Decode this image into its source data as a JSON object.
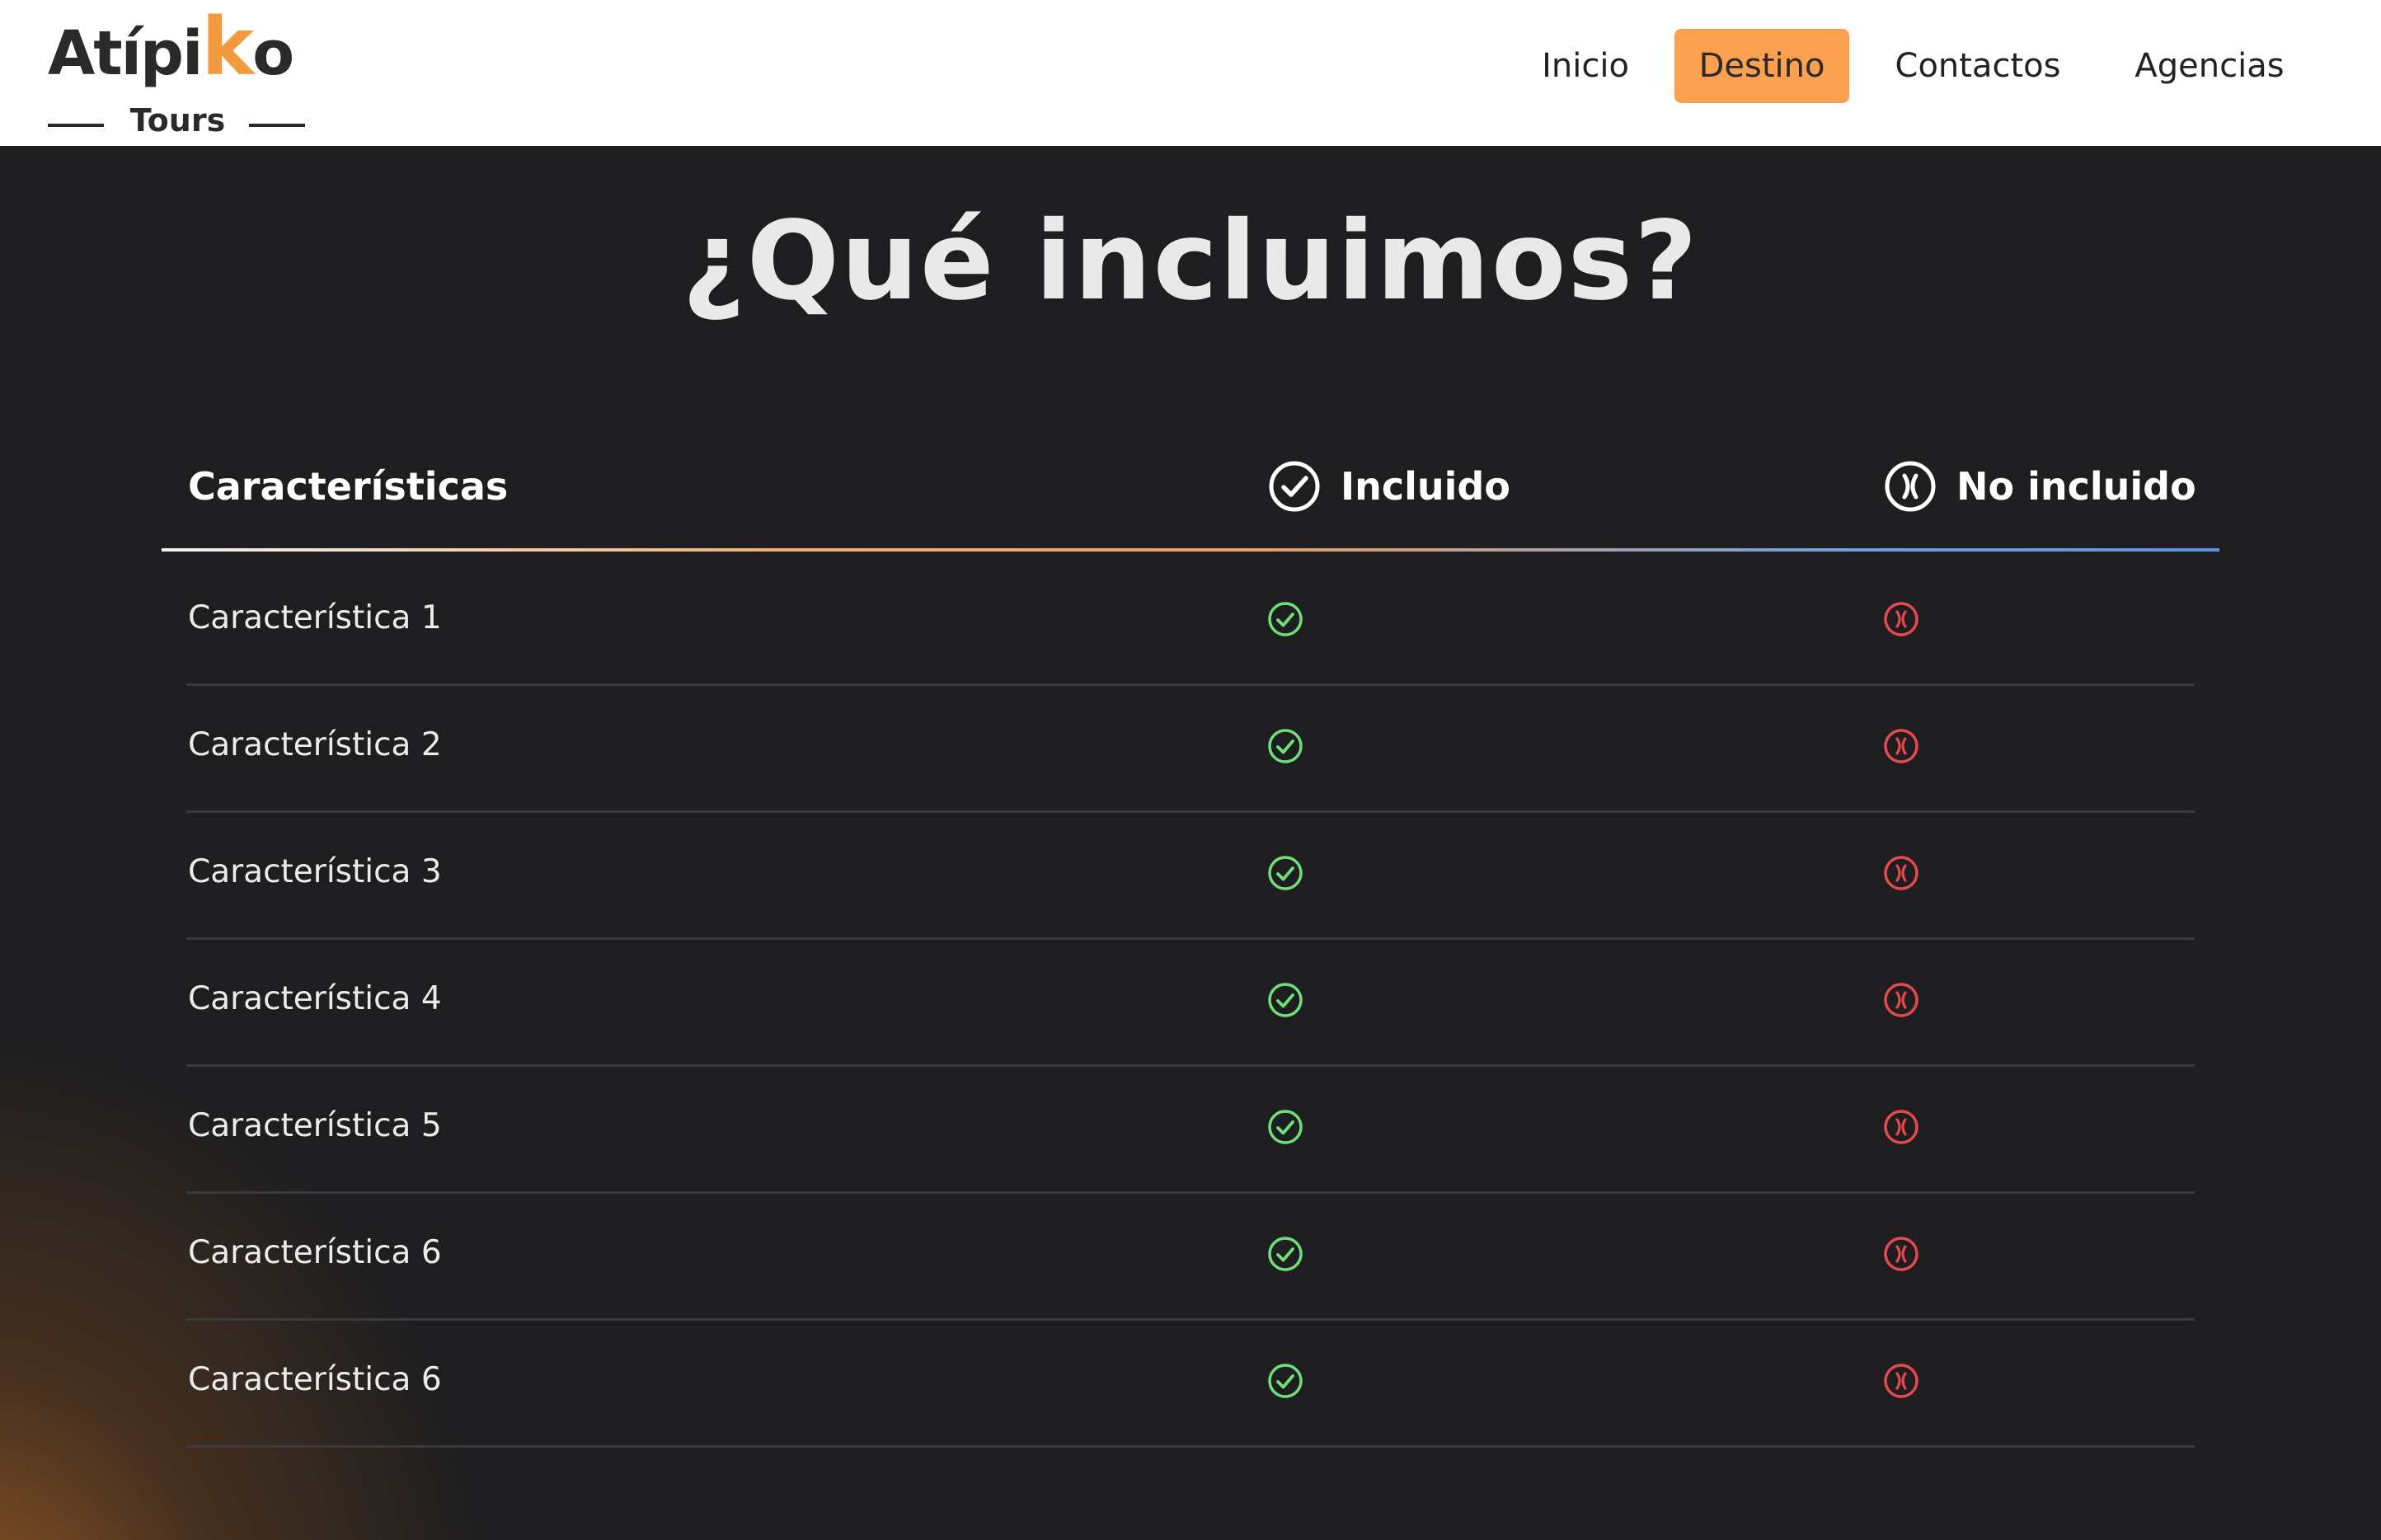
{
  "header": {
    "logo_text_part1": "Atípi",
    "logo_accent_letter": "k",
    "logo_text_part2": "o",
    "logo_sub": "Tours",
    "nav": [
      {
        "label": "Inicio",
        "active": false
      },
      {
        "label": "Destino",
        "active": true
      },
      {
        "label": "Contactos",
        "active": false
      },
      {
        "label": "Agencias",
        "active": false
      }
    ]
  },
  "main": {
    "title": "¿Qué incluimos?",
    "columns": {
      "features": "Características",
      "included": "Incluido",
      "not_included": "No incluido"
    },
    "rows": [
      {
        "label": "Característica 1",
        "included_icon": "check-circle-icon",
        "excluded_icon": "x-circle-icon"
      },
      {
        "label": "Característica 2",
        "included_icon": "check-circle-icon",
        "excluded_icon": "x-circle-icon"
      },
      {
        "label": "Característica 3",
        "included_icon": "check-circle-icon",
        "excluded_icon": "x-circle-icon"
      },
      {
        "label": "Característica 4",
        "included_icon": "check-circle-icon",
        "excluded_icon": "x-circle-icon"
      },
      {
        "label": "Característica 5",
        "included_icon": "check-circle-icon",
        "excluded_icon": "x-circle-icon"
      },
      {
        "label": "Característica 6",
        "included_icon": "check-circle-icon",
        "excluded_icon": "x-circle-icon"
      },
      {
        "label": "Característica 6",
        "included_icon": "check-circle-icon",
        "excluded_icon": "x-circle-icon"
      }
    ]
  },
  "colors": {
    "accent": "#fba04e",
    "background": "#1e1e20",
    "check": "#6ee07a",
    "cross": "#e5484d"
  }
}
